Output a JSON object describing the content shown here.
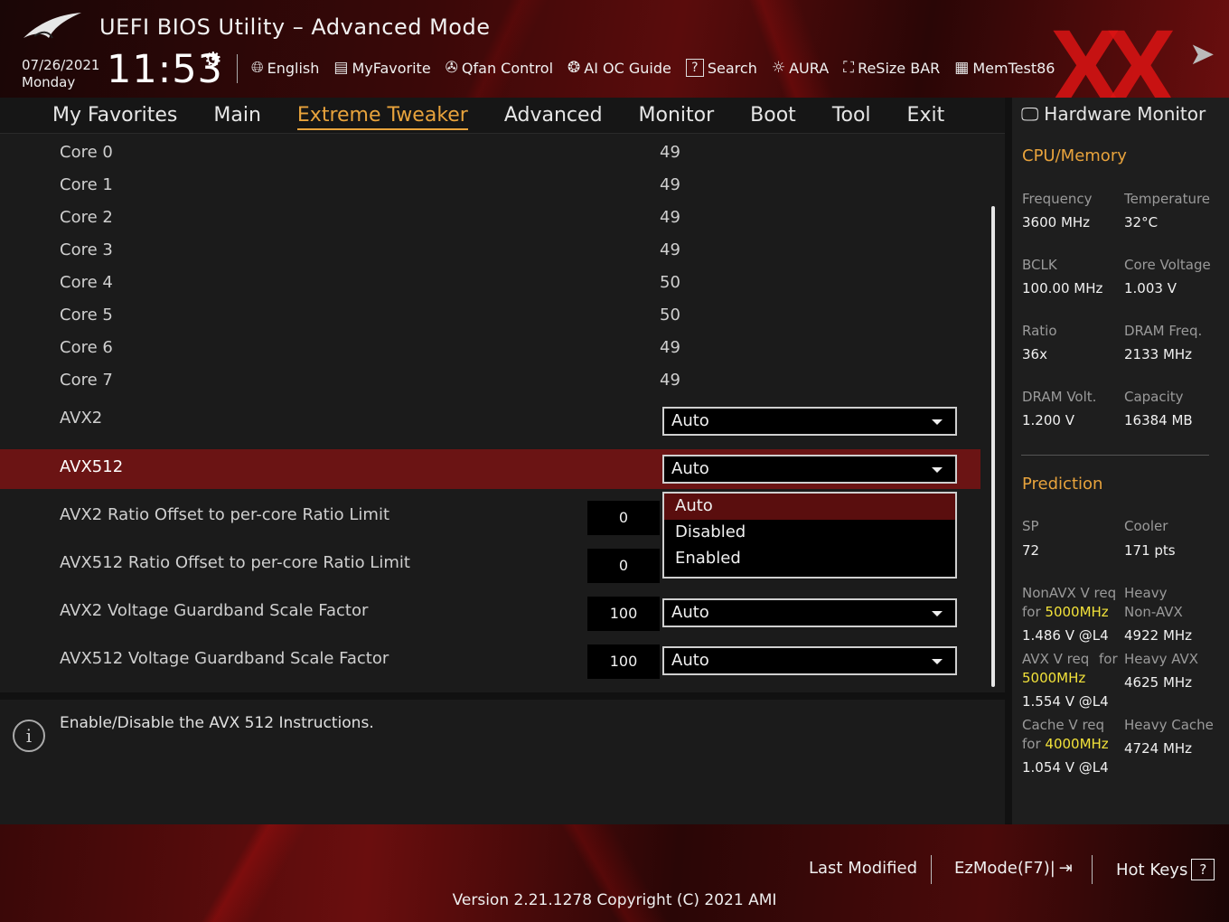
{
  "header": {
    "title": "UEFI BIOS Utility – Advanced Mode",
    "date": "07/26/2021",
    "day": "Monday",
    "time": "11:53",
    "toolbar": [
      {
        "label": "English",
        "icon": "globe-icon"
      },
      {
        "label": "MyFavorite",
        "icon": "favorite-icon"
      },
      {
        "label": "Qfan Control",
        "icon": "fan-icon"
      },
      {
        "label": "AI OC Guide",
        "icon": "ai-oc-icon"
      },
      {
        "label": "Search",
        "icon": "search-icon"
      },
      {
        "label": "AURA",
        "icon": "aura-icon"
      },
      {
        "label": "ReSize BAR",
        "icon": "resize-bar-icon"
      },
      {
        "label": "MemTest86",
        "icon": "memtest-icon"
      }
    ]
  },
  "nav": {
    "tabs": [
      "My Favorites",
      "Main",
      "Extreme Tweaker",
      "Advanced",
      "Monitor",
      "Boot",
      "Tool",
      "Exit"
    ],
    "active": "Extreme Tweaker"
  },
  "main": {
    "cores": [
      {
        "label": "Core 0",
        "value": "49"
      },
      {
        "label": "Core 1",
        "value": "49"
      },
      {
        "label": "Core 2",
        "value": "49"
      },
      {
        "label": "Core 3",
        "value": "49"
      },
      {
        "label": "Core 4",
        "value": "50"
      },
      {
        "label": "Core 5",
        "value": "50"
      },
      {
        "label": "Core 6",
        "value": "49"
      },
      {
        "label": "Core 7",
        "value": "49"
      }
    ],
    "avx2": {
      "label": "AVX2",
      "value": "Auto"
    },
    "avx512": {
      "label": "AVX512",
      "value": "Auto"
    },
    "avx512_options": [
      "Auto",
      "Disabled",
      "Enabled"
    ],
    "avx2_offset": {
      "label": "AVX2 Ratio Offset to per-core Ratio Limit",
      "number": "0"
    },
    "avx512_offset": {
      "label": "AVX512 Ratio Offset to per-core Ratio Limit",
      "number": "0"
    },
    "avx2_guardband": {
      "label": "AVX2 Voltage Guardband Scale Factor",
      "number": "100",
      "value": "Auto"
    },
    "avx512_guardband": {
      "label": "AVX512 Voltage Guardband Scale Factor",
      "number": "100",
      "value": "Auto"
    }
  },
  "help": {
    "text": "Enable/Disable the AVX 512 Instructions."
  },
  "hw": {
    "title": "Hardware Monitor",
    "cpu_section": "CPU/Memory",
    "frequency_label": "Frequency",
    "frequency": "3600 MHz",
    "temperature_label": "Temperature",
    "temperature": "32°C",
    "bclk_label": "BCLK",
    "bclk": "100.00 MHz",
    "core_voltage_label": "Core Voltage",
    "core_voltage": "1.003 V",
    "ratio_label": "Ratio",
    "ratio": "36x",
    "dram_freq_label": "DRAM Freq.",
    "dram_freq": "2133 MHz",
    "dram_volt_label": "DRAM Volt.",
    "dram_volt": "1.200 V",
    "capacity_label": "Capacity",
    "capacity": "16384 MB",
    "prediction_section": "Prediction",
    "sp_label": "SP",
    "sp": "72",
    "cooler_label": "Cooler",
    "cooler": "171 pts",
    "nonavx_label_1": "NonAVX V req",
    "nonavx_label_2": "for",
    "nonavx_freq": "5000MHz",
    "nonavx_v": "1.486 V @L4",
    "heavy_nonavx_label_1": "Heavy",
    "heavy_nonavx_label_2": "Non-AVX",
    "heavy_nonavx": "4922 MHz",
    "avx_label_1": "AVX V req",
    "avx_label_2": "for",
    "avx_freq": "5000MHz",
    "avx_v": "1.554 V @L4",
    "heavy_avx_label": "Heavy AVX",
    "heavy_avx": "4625 MHz",
    "cache_label_1": "Cache V req",
    "cache_label_2": "for",
    "cache_freq": "4000MHz",
    "cache_v": "1.054 V @L4",
    "heavy_cache_label": "Heavy Cache",
    "heavy_cache": "4724 MHz"
  },
  "footer": {
    "last_modified": "Last Modified",
    "ezmode": "EzMode(F7)|",
    "hotkeys": "Hot Keys",
    "hotkeys_key": "?",
    "version": "Version 2.21.1278 Copyright (C) 2021 AMI"
  },
  "colors": {
    "accent": "#e8a33c",
    "selection": "#6b1414",
    "highlight_value": "#f2e23a",
    "brand_red": "#d01818"
  }
}
